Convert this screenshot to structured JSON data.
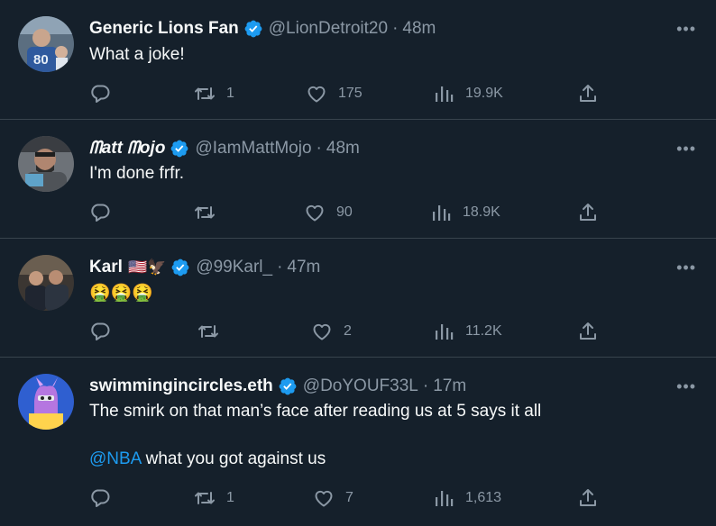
{
  "tweets": [
    {
      "name": "Generic Lions Fan",
      "handle": "@LionDetroit20",
      "time": "48m",
      "text": "What a joke!",
      "replies": "",
      "retweets": "1",
      "likes": "175",
      "views": "19.9K",
      "verified_icon": "verified-badge-icon"
    },
    {
      "name": "ᗰatt ᗰojo",
      "handle": "@IamMattMojo",
      "time": "48m",
      "text": "I'm done frfr.",
      "replies": "",
      "retweets": "",
      "likes": "90",
      "views": "18.9K",
      "verified_icon": "verified-badge-icon"
    },
    {
      "name": "Karl",
      "name_emoji": "🇺🇸🦅",
      "handle": "@99Karl_",
      "time": "47m",
      "text": "🤮🤮🤮",
      "replies": "",
      "retweets": "",
      "likes": "2",
      "views": "11.2K",
      "verified_icon": "verified-badge-icon"
    },
    {
      "name": "swimmingincircles.eth",
      "handle": "@DoYOUF33L",
      "time": "17m",
      "text": "The smirk on that man’s face after reading us at 5 says it all",
      "mention": "@NBA",
      "text2": " what you got against us",
      "replies": "",
      "retweets": "1",
      "likes": "7",
      "views": "1,613",
      "verified_icon": "verified-badge-icon"
    }
  ],
  "ui": {
    "dot": "·",
    "more": "•••"
  },
  "colors": {
    "background": "#15202b",
    "text": "#f7f9f9",
    "secondary": "#8b98a5",
    "accent": "#1d9bf0",
    "divider": "#38444d"
  }
}
